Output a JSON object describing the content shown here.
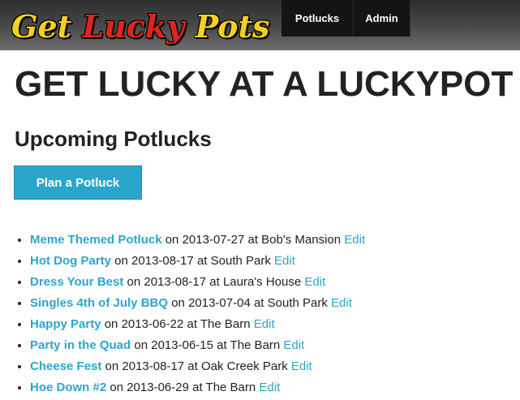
{
  "logo": {
    "word1": "Get",
    "word2": "Lucky",
    "word3": "Pots"
  },
  "nav": {
    "potlucks": "Potlucks",
    "admin": "Admin"
  },
  "heading": "GET LUCKY AT A LUCKYPOT",
  "subheading": "Upcoming Potlucks",
  "plan_button": "Plan a Potluck",
  "on_text": " on ",
  "at_text": " at ",
  "edit_label": "Edit",
  "potlucks": [
    {
      "name": "Meme Themed Potluck",
      "date": "2013-07-27",
      "location": "Bob's Mansion"
    },
    {
      "name": "Hot Dog Party",
      "date": "2013-08-17",
      "location": "South Park"
    },
    {
      "name": "Dress Your Best",
      "date": "2013-08-17",
      "location": "Laura's House"
    },
    {
      "name": "Singles 4th of July BBQ",
      "date": "2013-07-04",
      "location": "South Park"
    },
    {
      "name": "Happy Party",
      "date": "2013-06-22",
      "location": "The Barn"
    },
    {
      "name": "Party in the Quad",
      "date": "2013-06-15",
      "location": "The Barn"
    },
    {
      "name": "Cheese Fest",
      "date": "2013-08-17",
      "location": "Oak Creek Park"
    },
    {
      "name": "Hoe Down #2",
      "date": "2013-06-29",
      "location": "The Barn"
    }
  ],
  "colors": {
    "link": "#2ba6cb",
    "logo_yellow": "#f3d020",
    "logo_red": "#e02520"
  }
}
